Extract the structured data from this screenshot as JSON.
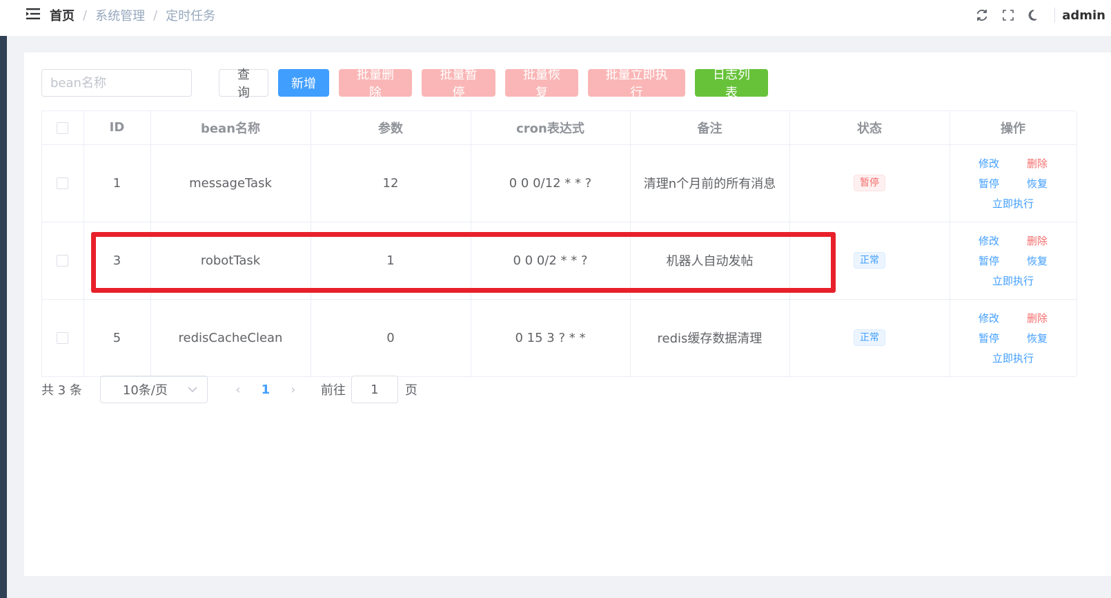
{
  "breadcrumb": [
    "首页",
    "系统管理",
    "定时任务"
  ],
  "user": {
    "name": "admin"
  },
  "search": {
    "placeholder": "bean名称",
    "value": ""
  },
  "toolbar": {
    "query_label": "查询",
    "add_label": "新增",
    "batch_delete_label": "批量删除",
    "batch_pause_label": "批量暂停",
    "batch_resume_label": "批量恢复",
    "batch_run_label": "批量立即执行",
    "log_list_label": "日志列表"
  },
  "table": {
    "columns": [
      "ID",
      "bean名称",
      "参数",
      "cron表达式",
      "备注",
      "状态",
      "操作"
    ],
    "rows": [
      {
        "id": "1",
        "bean": "messageTask",
        "param": "12",
        "cron": "0 0 0/12 * * ?",
        "remark": "清理n个月前的所有消息",
        "status": "暂停",
        "status_type": "paused"
      },
      {
        "id": "3",
        "bean": "robotTask",
        "param": "1",
        "cron": "0 0 0/2 * * ?",
        "remark": "机器人自动发帖",
        "status": "正常",
        "status_type": "normal"
      },
      {
        "id": "5",
        "bean": "redisCacheClean",
        "param": "0",
        "cron": "0 15 3 ? * *",
        "remark": "redis缓存数据清理",
        "status": "正常",
        "status_type": "normal"
      }
    ],
    "actions": {
      "edit": "修改",
      "delete": "删除",
      "pause": "暂停",
      "resume": "恢复",
      "run": "立即执行"
    }
  },
  "pagination": {
    "total_text": "共 3 条",
    "page_size": "10条/页",
    "current_page": "1",
    "goto_label": "前往",
    "goto_value": "1",
    "goto_suffix": "页"
  },
  "colors": {
    "primary": "#409eff",
    "danger": "#f56c6c",
    "success": "#67c23a",
    "highlight": "#e8202a"
  }
}
